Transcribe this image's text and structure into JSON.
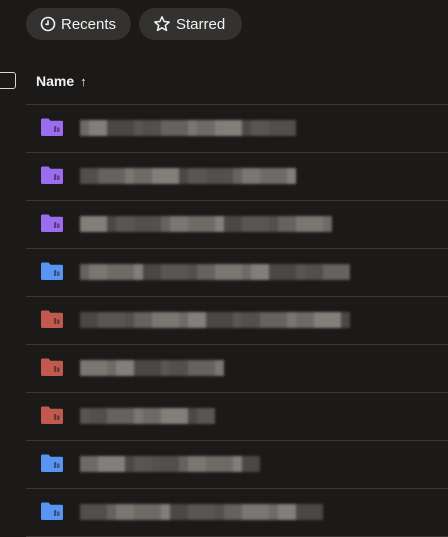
{
  "filters": {
    "recents_label": "Recents",
    "starred_label": "Starred"
  },
  "list_header": {
    "name_label": "Name",
    "sort_arrow": "↑"
  },
  "colors": {
    "background": "#1b1a19",
    "chip_bg": "#333231",
    "purple": "#9b6cf0",
    "blue": "#5a94f2",
    "red": "#c2594f"
  },
  "rows": [
    {
      "icon": "shared-folder-purple-icon",
      "color": "purple",
      "name": "",
      "pixelated": true
    },
    {
      "icon": "shared-folder-purple-icon",
      "color": "purple",
      "name": "",
      "pixelated": true
    },
    {
      "icon": "shared-folder-purple-icon",
      "color": "purple",
      "name": "",
      "pixelated": true
    },
    {
      "icon": "shared-folder-blue-icon",
      "color": "blue",
      "name": "",
      "pixelated": true
    },
    {
      "icon": "shared-folder-red-icon",
      "color": "red",
      "name": "",
      "pixelated": true
    },
    {
      "icon": "shared-folder-red-icon",
      "color": "red",
      "name": "",
      "pixelated": true
    },
    {
      "icon": "shared-folder-red-icon",
      "color": "red",
      "name": "",
      "pixelated": true
    },
    {
      "icon": "shared-folder-blue-icon",
      "color": "blue",
      "name": "",
      "pixelated": true
    },
    {
      "icon": "shared-folder-blue-icon",
      "color": "blue",
      "name": "",
      "pixelated": true
    }
  ]
}
